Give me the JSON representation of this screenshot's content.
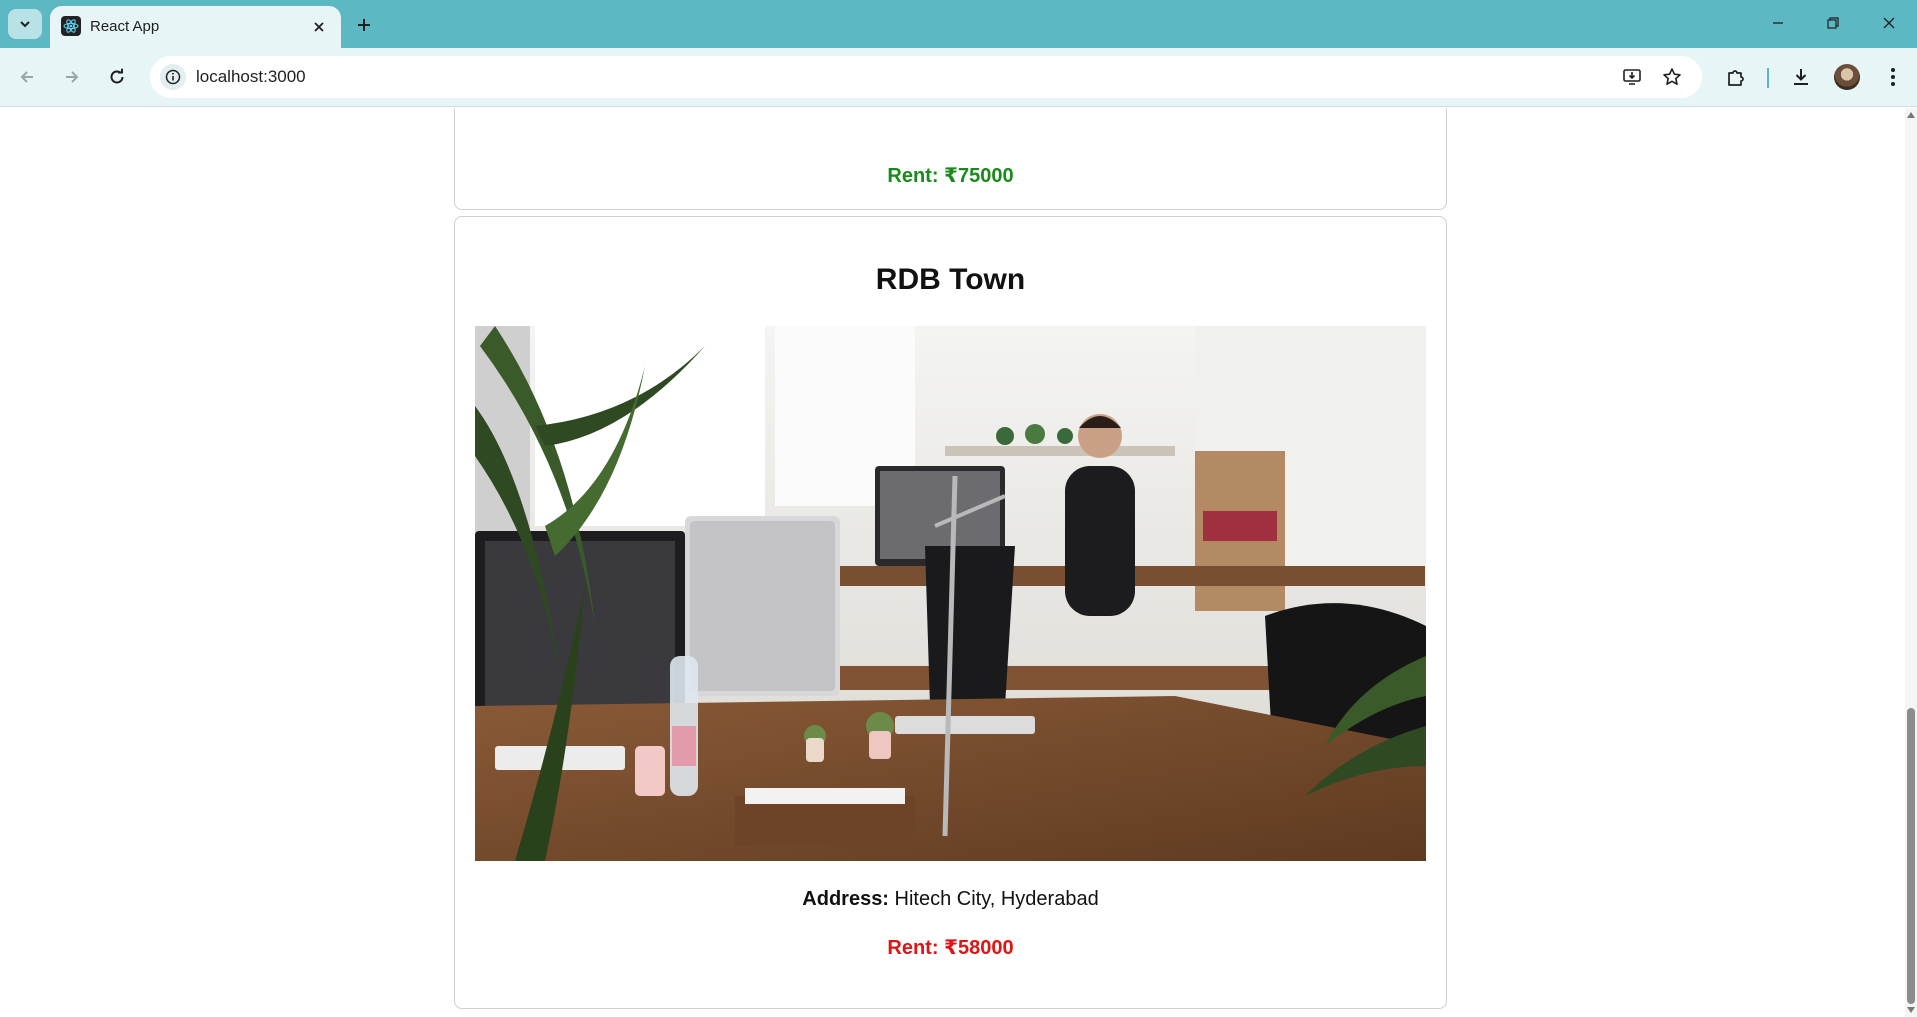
{
  "browser": {
    "tab_title": "React App",
    "url": "localhost:3000"
  },
  "previous_card": {
    "rent_label": "Rent: ₹75000"
  },
  "listing": {
    "title": "RDB Town",
    "address_label": "Address:",
    "address_value": "Hitech City, Hyderabad",
    "rent_label": "Rent: ₹58000",
    "image_description_icon": "office-photo"
  },
  "colors": {
    "chrome_accent": "#5cb8c2",
    "rent_green": "#1a8a1a",
    "rent_red": "#e01414"
  }
}
